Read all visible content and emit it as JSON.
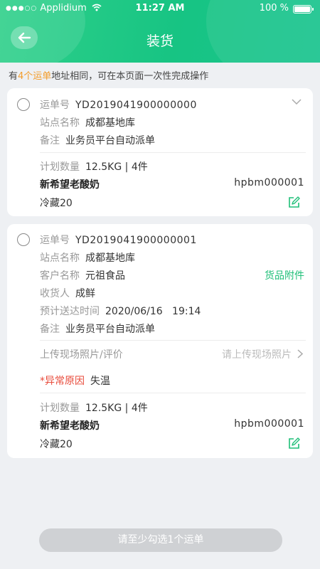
{
  "status_bar": {
    "carrier": "Applidium",
    "time": "11:27 AM",
    "battery": "100 %"
  },
  "header": {
    "title": "装货"
  },
  "info": {
    "prefix": "有",
    "count": "4个运单",
    "suffix": "地址相同，可在本页面一次性完成操作"
  },
  "orders": [
    {
      "order_label": "运单号",
      "order_no": "YD2019041900000000",
      "station_label": "站点名称",
      "station": "成都基地库",
      "remark_label": "备注",
      "remark": "业务员平台自动派单",
      "qty_label": "计划数量",
      "qty": "12.5KG | 4件",
      "product": "新希望老酸奶",
      "product_code": "hpbm000001",
      "storage": "冷藏20"
    },
    {
      "order_label": "运单号",
      "order_no": "YD2019041900000001",
      "station_label": "站点名称",
      "station": "成都基地库",
      "customer_label": "客户名称",
      "customer": "元祖食品",
      "attachment": "货品附件",
      "receiver_label": "收货人",
      "receiver": "成鲜",
      "eta_label": "预计送达时间",
      "eta": "2020/06/16   19:14",
      "remark_label": "备注",
      "remark": "业务员平台自动派单",
      "photo_label": "上传现场照片/评价",
      "photo_placeholder": "请上传现场照片",
      "exception_star": "*",
      "exception_label": "异常原因",
      "exception": "失温",
      "qty_label": "计划数量",
      "qty": "12.5KG | 4件",
      "product": "新希望老酸奶",
      "product_code": "hpbm000001",
      "storage": "冷藏20"
    }
  ],
  "submit": {
    "label": "请至少勾选1个运单"
  },
  "colors": {
    "accent": "#1fbf78",
    "highlight": "#f39c2a",
    "danger": "#e84a3a"
  }
}
